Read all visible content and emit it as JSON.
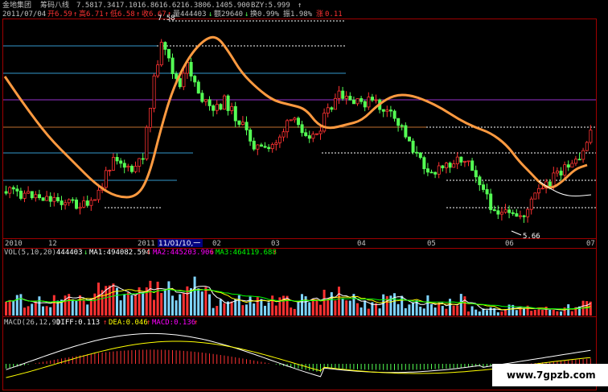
{
  "header": {
    "title": "金地集团",
    "indicator_name": "筹码八线",
    "indicator_values": [
      "7.581",
      "7.341",
      "7.101",
      "6.861",
      "6.621",
      "6.380",
      "6.140",
      "5.900"
    ],
    "bzy": "BZY:5.999",
    "bzy_arrow": "↑",
    "date": "2011/07/04",
    "open_label": "开",
    "open_value": "6.59",
    "high_label": "高",
    "high_value": "6.71",
    "low_label": "低",
    "low_value": "6.58",
    "close_label": "收",
    "close_value": "6.67",
    "volume_label": "量",
    "volume_value": "444403",
    "amount_label": "额",
    "amount_value": "29640",
    "turnover_label": "换",
    "turnover_value": "0.99%",
    "amplitude_label": "振",
    "amplitude_value": "1.98%",
    "change_label": "涨",
    "change_value": "0.11"
  },
  "top_price_label": "7.58",
  "low_price_label": "5.66",
  "x_axis": {
    "labels": [
      "2010",
      "12",
      "2011",
      "11/01/10,一",
      "02",
      "03",
      "04",
      "05",
      "06",
      "07"
    ]
  },
  "volume_panel": {
    "title": "VOL(5,10,20)",
    "value": "444403",
    "value_arrow": "↓",
    "ma1": "MA1:494082.594",
    "ma1_arrow": "↑",
    "ma2": "MA2:445203.906",
    "ma2_arrow": "↑",
    "ma3": "MA3:464119.688",
    "ma3_arrow": "↑"
  },
  "macd_panel": {
    "title": "MACD(26,12,9)",
    "diff": "DIFF:0.113",
    "diff_arrow": "↑",
    "dea": "DEA:0.046",
    "dea_arrow": "↑",
    "macd": "MACD:0.136",
    "macd_arrow": "↑"
  },
  "watermark": "www.7gpzb.com",
  "colors": {
    "background": "#000000",
    "up": "#ff3232",
    "down": "#54ff54",
    "frame": "#a00000",
    "ma_orange": "#ff9a40",
    "chip_blue": "#3399cc",
    "chip_purple": "#9933cc",
    "chip_orange": "#c07030",
    "dotted": "#ffffff",
    "text": "#c0c0c0",
    "yellow": "#ffff00",
    "vol_up": "#ff3232",
    "vol_down": "#7fd4ff",
    "ma_white": "#ffffff",
    "ma_yellow": "#ffff00",
    "ma_magenta": "#ff00ff",
    "ma_green": "#00ff00"
  },
  "chart_data": [
    {
      "type": "candlestick",
      "title": "金地集团",
      "x_range": [
        "2010",
        "2011-07-04"
      ],
      "y_range_approx": [
        5.6,
        7.7
      ],
      "horizontal_levels": [
        7.581,
        7.341,
        7.101,
        6.861,
        6.621,
        6.38,
        6.14,
        5.9
      ],
      "last_candle": {
        "open": 6.59,
        "high": 6.71,
        "low": 6.58,
        "close": 6.67
      },
      "max_marker": 7.58,
      "min_marker": 5.66,
      "series": [
        {
          "name": "BZY",
          "last_value": 5.999
        }
      ]
    },
    {
      "type": "bar",
      "title": "VOL(5,10,20)",
      "last_volume": 444403,
      "series": [
        {
          "name": "MA1",
          "last_value": 494082.594
        },
        {
          "name": "MA2",
          "last_value": 445203.906
        },
        {
          "name": "MA3",
          "last_value": 464119.688
        }
      ]
    },
    {
      "type": "line",
      "title": "MACD(26,12,9)",
      "series": [
        {
          "name": "DIFF",
          "last_value": 0.113
        },
        {
          "name": "DEA",
          "last_value": 0.046
        },
        {
          "name": "MACD",
          "last_value": 0.136
        }
      ]
    }
  ]
}
